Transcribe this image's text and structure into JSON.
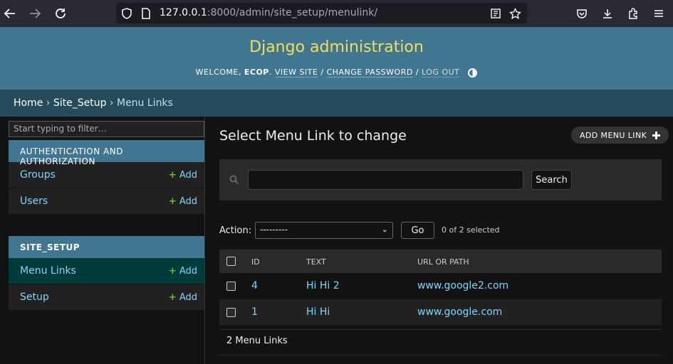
{
  "browser": {
    "url_host": "127.0.0.1",
    "url_rest": ":8000/admin/site_setup/menulink/"
  },
  "header": {
    "branding": "Django administration",
    "welcome": "WELCOME, ",
    "username": "ECOP",
    "view_site": "VIEW SITE",
    "change_password": "CHANGE PASSWORD",
    "log_out": "LOG OUT",
    "separator": " / "
  },
  "breadcrumbs": {
    "home": "Home",
    "app": "Site_Setup",
    "current": "Menu Links",
    "sep": " › "
  },
  "sidebar": {
    "filter_placeholder": "Start typing to filter…",
    "modules": [
      {
        "caption": "AUTHENTICATION AND AUTHORIZATION",
        "rows": [
          {
            "label": "Groups",
            "add": "Add"
          },
          {
            "label": "Users",
            "add": "Add"
          }
        ]
      },
      {
        "caption": "SITE_SETUP",
        "rows": [
          {
            "label": "Menu Links",
            "add": "Add"
          },
          {
            "label": "Setup",
            "add": "Add"
          }
        ]
      }
    ]
  },
  "main": {
    "title": "Select Menu Link to change",
    "add_button": "ADD MENU LINK",
    "search_button": "Search",
    "action_label": "Action:",
    "action_selected": "---------",
    "go_button": "Go",
    "selected_count": "0 of 2 selected",
    "columns": [
      "ID",
      "TEXT",
      "URL OR PATH"
    ],
    "rows": [
      {
        "id": "4",
        "text": "Hi Hi 2",
        "url": "www.google2.com"
      },
      {
        "id": "1",
        "text": "Hi Hi",
        "url": "www.google.com"
      }
    ],
    "paginator": "2 Menu Links"
  },
  "colors": {
    "header_bg": "#417690",
    "branding": "#f5dd5d",
    "breadcrumb_bg": "#264b5d",
    "link": "#81d4fa",
    "add_plus": "#70bf2b",
    "current_row": "#003a3a"
  }
}
